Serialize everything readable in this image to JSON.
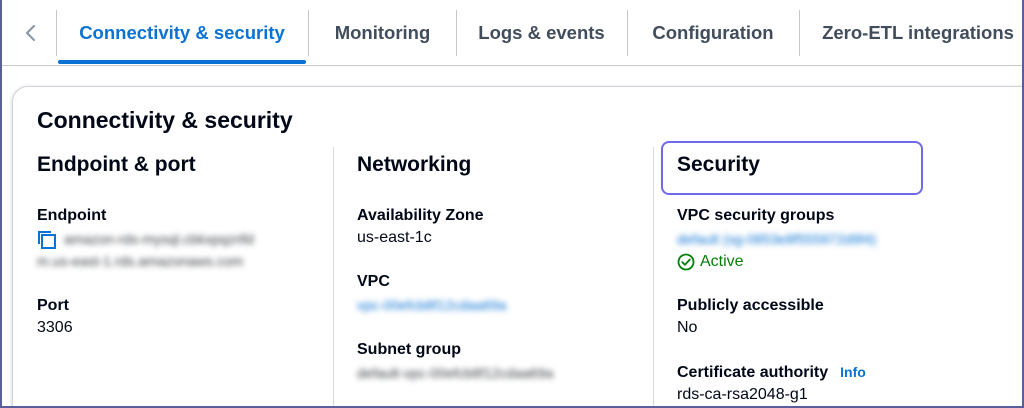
{
  "tabs": [
    {
      "label": "Connectivity & security",
      "active": true
    },
    {
      "label": "Monitoring",
      "active": false
    },
    {
      "label": "Logs & events",
      "active": false
    },
    {
      "label": "Configuration",
      "active": false
    },
    {
      "label": "Zero-ETL integrations",
      "active": false
    }
  ],
  "back_icon": "chevron-left-icon",
  "card": {
    "title": "Connectivity & security",
    "endpoint_port": {
      "title": "Endpoint & port",
      "endpoint_label": "Endpoint",
      "endpoint_value_line1": "amazon-rds-mysql.cbkxpqzrifd",
      "endpoint_value_line2": "m.us-east-1.rds.amazonaws.com",
      "copy_icon": "copy-icon",
      "port_label": "Port",
      "port_value": "3306"
    },
    "networking": {
      "title": "Networking",
      "az_label": "Availability Zone",
      "az_value": "us-east-1c",
      "vpc_label": "VPC",
      "vpc_value": "vpc-00efcb8f12cdaa69a",
      "subnet_label": "Subnet group",
      "subnet_value": "default-vpc-00efcb8f12cdaa69a"
    },
    "security": {
      "title": "Security",
      "sg_label": "VPC security groups",
      "sg_value": "default (sg-0853e8f555972d9f4)",
      "sg_status": "Active",
      "status_icon": "check-circle-icon",
      "public_label": "Publicly accessible",
      "public_value": "No",
      "ca_label": "Certificate authority",
      "ca_info": "Info",
      "ca_value": "rds-ca-rsa2048-g1"
    }
  },
  "colors": {
    "accent": "#0972d3",
    "success": "#037f0c",
    "highlight": "#6e6ae8",
    "text": "#000716",
    "tab_inactive": "#414d5c"
  }
}
